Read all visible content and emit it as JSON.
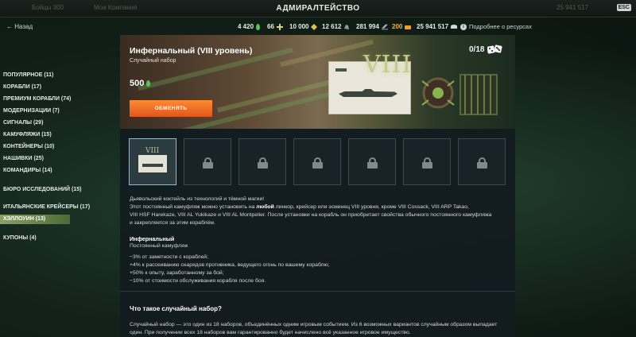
{
  "topbar": {
    "title": "АДМИРАЛТЕЙСТВО",
    "esc_label": "ESC",
    "faded_left": "Бойцы 300",
    "faded_left2": "Мои Компания",
    "faded_right": "25 941 517"
  },
  "header": {
    "back_label": "Назад",
    "resources": [
      {
        "value": "4 420",
        "icon": "green-drop-icon",
        "color": "#58c25b"
      },
      {
        "value": "66",
        "icon": "cross-token-icon",
        "color": "#d9d37a"
      },
      {
        "value": "10 000",
        "icon": "diamond-token-icon",
        "color": "#e2bc55"
      },
      {
        "value": "12 612",
        "icon": "coal-icon",
        "color": "#8b9aa0"
      },
      {
        "value": "281 994",
        "icon": "steel-icon",
        "color": "#a8b1b5"
      },
      {
        "value": "200",
        "icon": "doubloon-icon",
        "color": "#e8a030"
      },
      {
        "value": "25 941 517",
        "icon": "credits-icon",
        "color": "#cfd6d8"
      }
    ],
    "info_label": "Подробнее о ресурсах"
  },
  "sidebar": {
    "items": [
      {
        "label": "ПОПУЛЯРНОЕ (11)"
      },
      {
        "label": "КОРАБЛИ (17)"
      },
      {
        "label": "ПРЕМИУМ КОРАБЛИ (74)"
      },
      {
        "label": "МОДЕРНИЗАЦИИ (7)"
      },
      {
        "label": "СИГНАЛЫ (29)"
      },
      {
        "label": "КАМУФЛЯЖИ (15)"
      },
      {
        "label": "КОНТЕЙНЕРЫ (10)"
      },
      {
        "label": "НАШИВКИ (25)"
      },
      {
        "label": "КОМАНДИРЫ (14)"
      },
      {
        "label": "БЮРО ИССЛЕДОВАНИЙ (15)"
      },
      {
        "label": "ИТАЛЬЯНСКИЕ КРЕЙСЕРЫ (17)"
      },
      {
        "label": "ХЭЛЛОУИН (13)"
      },
      {
        "label": "КУПОНЫ (4)"
      }
    ],
    "active_index": 11
  },
  "banner": {
    "title": "Инфернальный (VIII уровень)",
    "subtitle": "Случайный набор",
    "price": "500",
    "exchange_label": "ОБМЕНЯТЬ",
    "count": "0/18",
    "tier": "VIII"
  },
  "description": {
    "line1": "Дьявольский коктейль из технологий и тёмной магии!",
    "line2a": "Этот постоянный камуфляж можно установить на ",
    "line2b": "любой",
    "line2c": " линкор, крейсер или эсминец VIII уровня, кроме VIII Cossack, VIII ARP Takao,",
    "line3": "VIII HSF Harekaze, VIII AL Yukikaze и VIII AL Montpelier. После установки на корабль он приобретает свойства обычного постоянного камуфляжа",
    "line4": "и закрепляется за этим кораблём."
  },
  "camo": {
    "title": "Инфернальный",
    "subtitle": "Постоянный камуфляж",
    "bonuses": [
      "−3% от заметности с кораблей;",
      "+4% к рассеиванию снарядов противника, ведущего огонь по вашему кораблю;",
      "+50% к опыту, заработанному за бой;",
      "−10% от стоимости обслуживания корабля после боя."
    ]
  },
  "faq": {
    "question": "Что такое случайный набор?",
    "answer": "Случайный набор — это один из 18 наборов, объединённых одним игровым событием. Из 6 возможных вариантов случайным образом выпадает один. При получении всех 18 наборов вам гарантированно будет начислено всё указанное игровое имущество."
  }
}
